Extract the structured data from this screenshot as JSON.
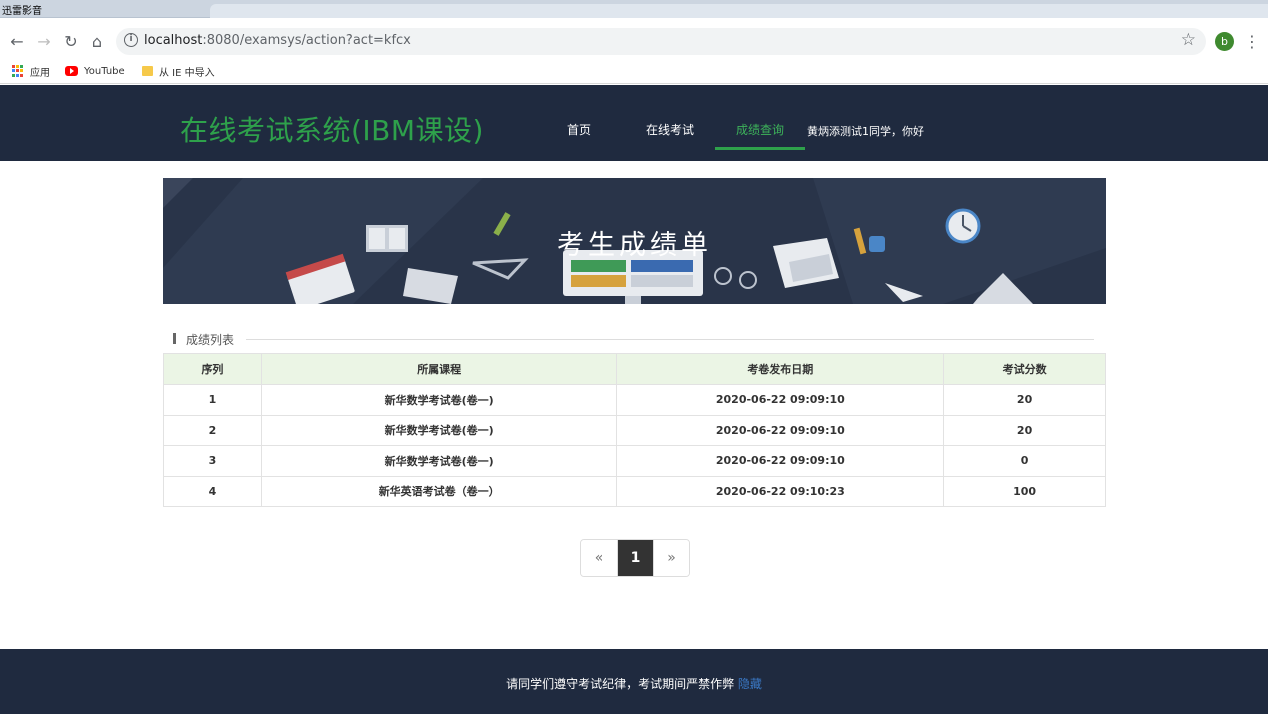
{
  "window": {
    "title": "迅雷影音"
  },
  "browser": {
    "url_host": "localhost",
    "url_rest": ":8080/examsys/action?act=kfcx",
    "profile_initial": "b",
    "bookmarks": [
      "应用",
      "YouTube",
      "从 IE 中导入"
    ]
  },
  "site": {
    "logo": "在线考试系统(IBM课设)",
    "nav": [
      "首页",
      "在线考试",
      "成绩查询"
    ],
    "active_nav": "成绩查询",
    "greeting": "黄炳添测试1同学，你好",
    "accent_color": "#2ea14b",
    "header_bg": "#1f2a3f"
  },
  "banner": {
    "title": "考生成绩单"
  },
  "list": {
    "section_title": "成绩列表",
    "columns": [
      "序列",
      "所属课程",
      "考卷发布日期",
      "考试分数"
    ],
    "rows": [
      [
        "1",
        "新华数学考试卷(卷一)",
        "2020-06-22 09:09:10",
        "20"
      ],
      [
        "2",
        "新华数学考试卷(卷一)",
        "2020-06-22 09:09:10",
        "20"
      ],
      [
        "3",
        "新华数学考试卷(卷一)",
        "2020-06-22 09:09:10",
        "0"
      ],
      [
        "4",
        "新华英语考试卷（卷一）",
        "2020-06-22 09:10:23",
        "100"
      ]
    ]
  },
  "pager": {
    "prev": "«",
    "current": "1",
    "next": "»"
  },
  "footer": {
    "text": "请同学们遵守考试纪律，考试期间严禁作弊",
    "link": "隐藏"
  }
}
